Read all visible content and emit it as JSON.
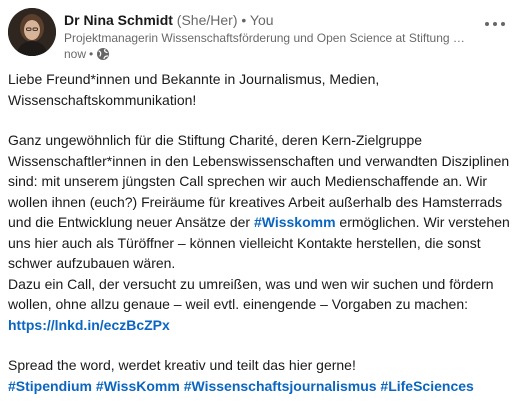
{
  "author": {
    "name": "Dr Nina Schmidt",
    "pronouns": "(She/Her)",
    "separator": "•",
    "relation": "You",
    "headline": "Projektmanagerin Wissenschaftsförderung und Open Science at Stiftung Charité",
    "time": "now",
    "time_separator": "•",
    "visibility_icon": "globe-icon"
  },
  "more_icon": "ellipsis-icon",
  "post": {
    "p1": "Liebe Freund*innen und Bekannte in Journalismus, Medien, Wissenschaftskommunikation!",
    "p2_a": "Ganz ungewöhnlich für die Stiftung Charité, deren Kern-Zielgruppe Wissenschaftler*innen in den Lebenswissenschaften und verwandten Disziplinen sind: mit unserem jüngsten Call sprechen wir auch Medienschaffende an. Wir wollen ihnen (euch?) Freiräume für kreatives Arbeit außerhalb des Hamsterrads und die Entwicklung neuer Ansätze der ",
    "hashtag_wisskomm": "#Wisskomm",
    "p2_b": " ermöglichen. Wir verstehen uns hier auch als Türöffner – können vielleicht Kontakte herstellen, die sonst schwer aufzubauen wären.",
    "p3": "Dazu ein Call, der versucht zu umreißen, was und wen wir suchen und fördern wollen, ohne allzu genaue – weil evtl. einengende – Vorgaben zu machen:",
    "url": "https://lnkd.in/eczBcZPx",
    "p4": "Spread the word, werdet kreativ und teilt das hier gerne!",
    "hashtags": [
      "#Stipendium",
      "#WissKomm",
      "#Wissenschaftsjournalismus",
      "#LifeSciences"
    ]
  },
  "colors": {
    "link": "#0a66c2",
    "text": "#191919",
    "muted": "#666666"
  }
}
